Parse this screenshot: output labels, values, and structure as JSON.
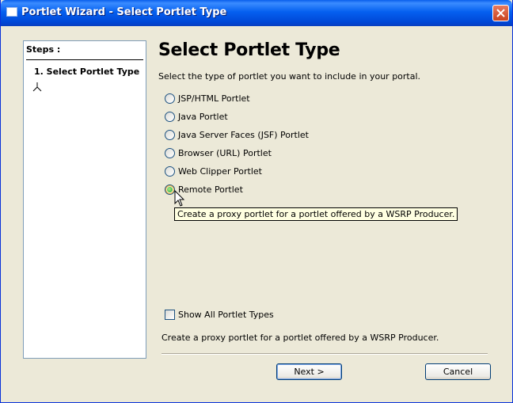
{
  "window": {
    "title": "Portlet Wizard - Select Portlet Type",
    "title_icon": "window-icon",
    "close_icon": "close-icon"
  },
  "steps": {
    "header": "Steps :",
    "items": [
      {
        "label": "1. Select Portlet Type",
        "active": true
      }
    ],
    "marker_icon": "branch-arrow-icon"
  },
  "main": {
    "title": "Select Portlet Type",
    "description": "Select the type of portlet you want to include in your portal.",
    "options": [
      {
        "label": "JSP/HTML Portlet",
        "selected": false
      },
      {
        "label": "Java Portlet",
        "selected": false
      },
      {
        "label": "Java Server Faces (JSF) Portlet",
        "selected": false
      },
      {
        "label": "Browser (URL) Portlet",
        "selected": false
      },
      {
        "label": "Web Clipper Portlet",
        "selected": false
      },
      {
        "label": "Remote Portlet",
        "selected": true
      }
    ],
    "tooltip": "Create a proxy portlet for a portlet offered by a WSRP Producer.",
    "show_all": {
      "label": "Show All Portlet Types",
      "checked": false
    },
    "status_text": "Create a proxy portlet for a portlet offered by a WSRP Producer."
  },
  "buttons": {
    "next": "Next >",
    "cancel": "Cancel"
  },
  "colors": {
    "titlebar": "#0560f0",
    "background": "#ece9d8",
    "tooltip_bg": "#ffffe1",
    "radio_selected": "#21a121"
  }
}
